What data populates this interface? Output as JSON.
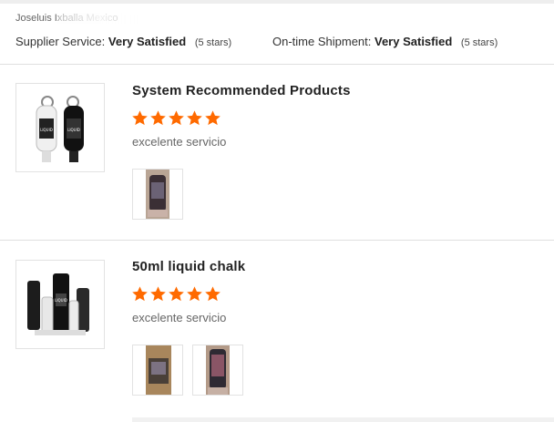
{
  "reviewer": {
    "name": "Joseluis Ixballa Mexico"
  },
  "ratings": {
    "supplier": {
      "label": "Supplier Service:",
      "value": "Very Satisfied",
      "stars": "(5 stars)"
    },
    "shipment": {
      "label": "On-time Shipment:",
      "value": "Very Satisfied",
      "stars": "(5 stars)"
    }
  },
  "reviews": [
    {
      "title": "System Recommended Products",
      "rating": 5,
      "comment": "excelente servicio",
      "photo_count": 1
    },
    {
      "title": "50ml liquid chalk",
      "rating": 5,
      "comment": "excelente servicio",
      "photo_count": 2
    }
  ],
  "colors": {
    "star": "#ff6a00",
    "divider": "#e0e0e0"
  }
}
